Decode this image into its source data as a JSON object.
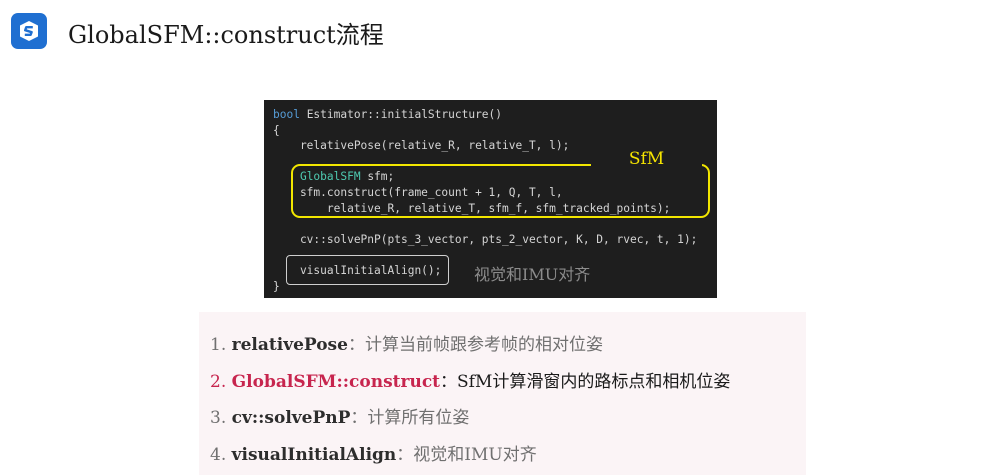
{
  "header": {
    "logo_icon": "s-shield-icon",
    "title": "GlobalSFM::construct流程"
  },
  "code": {
    "lines": [
      [
        {
          "t": "bool",
          "c": "kw"
        },
        {
          "t": " Estimator::initialStructure()",
          "c": ""
        }
      ],
      [
        {
          "t": "{",
          "c": ""
        }
      ],
      [
        {
          "t": "    relativePose(relative_R, relative_T, l);",
          "c": ""
        }
      ],
      [
        {
          "t": "",
          "c": ""
        }
      ],
      [
        {
          "t": "    ",
          "c": ""
        },
        {
          "t": "GlobalSFM",
          "c": "type"
        },
        {
          "t": " sfm;",
          "c": ""
        }
      ],
      [
        {
          "t": "    sfm.construct(frame_count + 1, Q, T, l,",
          "c": ""
        }
      ],
      [
        {
          "t": "        relative_R, relative_T, sfm_f, sfm_tracked_points);",
          "c": ""
        }
      ],
      [
        {
          "t": "",
          "c": ""
        }
      ],
      [
        {
          "t": "    cv::solvePnP(pts_3_vector, pts_2_vector, K, D, rvec, t, 1);",
          "c": ""
        }
      ],
      [
        {
          "t": "",
          "c": ""
        }
      ],
      [
        {
          "t": "    visualInitialAlign();",
          "c": ""
        }
      ],
      [
        {
          "t": "}",
          "c": ""
        }
      ]
    ],
    "sfm_label": "SfM",
    "align_label": "视觉和IMU对齐"
  },
  "steps": [
    {
      "num": "1.",
      "name": "relativePose",
      "sep": "：",
      "desc": "计算当前帧跟参考帧的相对位姿",
      "active": false
    },
    {
      "num": "2.",
      "name": "GlobalSFM::construct",
      "sep": "：",
      "desc": "SfM计算滑窗内的路标点和相机位姿",
      "active": true
    },
    {
      "num": "3.",
      "name": "cv::solvePnP",
      "sep": "：",
      "desc": "计算所有位姿",
      "active": false
    },
    {
      "num": "4.",
      "name": "visualInitialAlign",
      "sep": "：",
      "desc": "视觉和IMU对齐",
      "active": false
    }
  ],
  "colors": {
    "logo_bg": "#1f6fd1",
    "highlight_box": "#f2e600",
    "active_step": "#c7254e",
    "panel_bg": "#fbf4f6"
  }
}
